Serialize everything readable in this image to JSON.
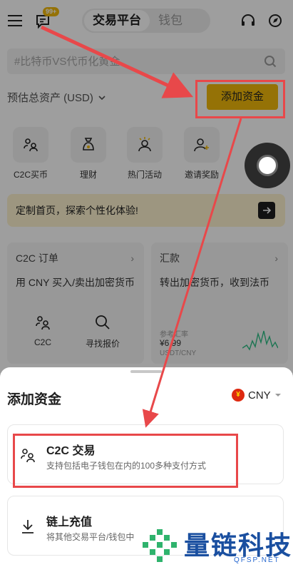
{
  "topbar": {
    "notification_badge": "99+",
    "tabs": [
      {
        "label": "交易平台",
        "active": true
      },
      {
        "label": "钱包",
        "active": false
      }
    ]
  },
  "search": {
    "placeholder": "#比特币VS代币化黄金"
  },
  "assets": {
    "label": "预估总资产 (USD)",
    "add_funds_label": "添加资金"
  },
  "shortcuts": [
    {
      "label": "C2C买币",
      "icon": "people-swap-icon"
    },
    {
      "label": "理财",
      "icon": "money-bag-icon"
    },
    {
      "label": "热门活动",
      "icon": "person-sparkle-icon"
    },
    {
      "label": "邀请奖励",
      "icon": "person-add-icon"
    }
  ],
  "banner": {
    "text": "定制首页，探索个性化体验!"
  },
  "cards": {
    "c2c": {
      "title": "C2C 订单",
      "desc": "用 CNY 买入/卖出加密货币",
      "actions": [
        {
          "label": "C2C"
        },
        {
          "label": "寻找报价"
        }
      ]
    },
    "remit": {
      "title": "汇款",
      "desc": "转出加密货币，收到法币",
      "rate_label": "参考汇率",
      "rate_value": "¥6.99",
      "rate_pair": "USDT/CNY"
    }
  },
  "sheet": {
    "title": "添加资金",
    "currency": "CNY",
    "options": [
      {
        "title": "C2C 交易",
        "subtitle": "支持包括电子钱包在内的100多种支付方式"
      },
      {
        "title": "链上充值",
        "subtitle": "将其他交易平台/钱包中"
      }
    ]
  },
  "watermark": {
    "text": "量链科技",
    "url": "QFSP.NET"
  },
  "colors": {
    "accent": "#f0b90b",
    "annotation": "#e8484a"
  }
}
